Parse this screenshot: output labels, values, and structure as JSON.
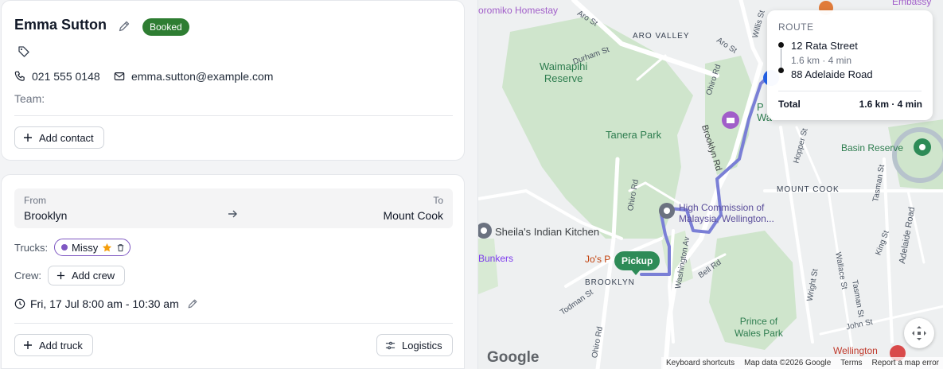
{
  "contact": {
    "name": "Emma Sutton",
    "status": "Booked",
    "phone": "021 555 0148",
    "email": "emma.sutton@example.com",
    "team_label": "Team:",
    "add_contact": "Add contact"
  },
  "job": {
    "from_label": "From",
    "from": "Brooklyn",
    "to_label": "To",
    "to": "Mount Cook",
    "trucks_label": "Trucks:",
    "truck_name": "Missy",
    "crew_label": "Crew:",
    "add_crew": "Add crew",
    "datetime": "Fri, 17 Jul 8:00 am - 10:30 am",
    "add_truck": "Add truck",
    "logistics": "Logistics"
  },
  "colors": {
    "booked_badge": "#2e7d32",
    "truck_purple": "#7e57c2",
    "route_line": "#7a7fd6",
    "park_green": "#cfe8cf",
    "pickup_marker": "#2e8b57"
  },
  "map": {
    "labels": {
      "homestay": "oromiko Homestay",
      "aro_valley": "ARO VALLEY",
      "aro_st": "Aro St",
      "aro_st2": "Aro St",
      "durham": "Durham St",
      "waimapihi": "Waimapihi\nReserve",
      "ohiro_rd_top": "Ohiro Rd",
      "tanera": "Tanera Park",
      "brooklyn_rd": "Brooklyn Rd",
      "high_commission": "High Commission of\nMalaysia, Wellington...",
      "sheila": "Sheila's Indian Kitchen",
      "bunkers": "Bunkers",
      "jos": "Jo's P",
      "brooklyn": "BROOKLYN",
      "washington": "Washington Av",
      "bell": "Bell Rd",
      "todman": "Todman St",
      "ohiro_rd_bottom": "Ohiro Rd",
      "ohiro_rd_mid": "Ohiro Rd",
      "prince_wales": "Prince of\nWales Park",
      "mount_cook": "MOUNT COOK",
      "basin": "Basin Reserve",
      "hopper": "Hopper St",
      "tasman": "Tasman St",
      "tasman2": "Tasman St",
      "adelaide": "Adelaide Road",
      "wallace": "Wallace St",
      "wright": "Wright St",
      "king": "King St",
      "john": "John St",
      "wellington": "Wellington",
      "willis": "Willis St",
      "embassy": "Embassy",
      "pw": "P\nWa"
    },
    "pickup_label": "Pickup",
    "route_card": {
      "title": "ROUTE",
      "stop1": "12 Rata Street",
      "leg": "1.6 km · 4 min",
      "stop2": "88 Adelaide Road",
      "total_label": "Total",
      "total_value": "1.6 km · 4 min"
    },
    "google": "Google",
    "attribution": {
      "shortcuts": "Keyboard shortcuts",
      "data": "Map data ©2026 Google",
      "terms": "Terms",
      "report": "Report a map error"
    }
  }
}
